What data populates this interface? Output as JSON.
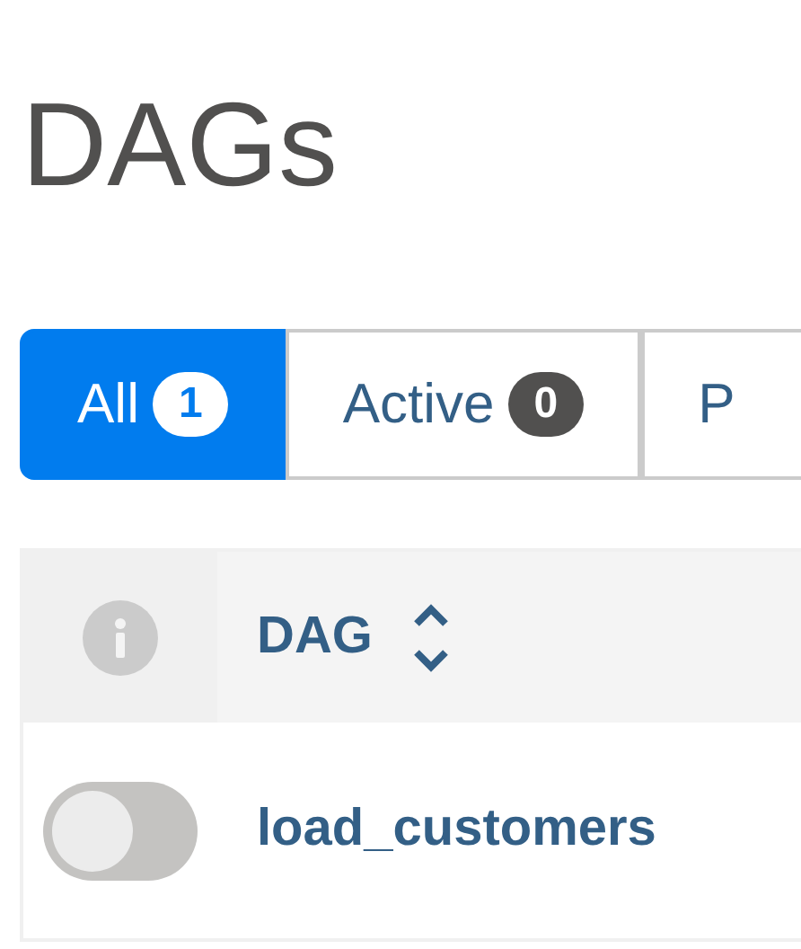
{
  "title": "DAGs",
  "tabs": [
    {
      "label": "All",
      "count": "1",
      "selected": true
    },
    {
      "label": "Active",
      "count": "0",
      "selected": false
    },
    {
      "label": "P",
      "selected": false
    }
  ],
  "table": {
    "columns": [
      "DAG"
    ],
    "rows": [
      {
        "on": false,
        "dag": "load_customers"
      }
    ]
  }
}
